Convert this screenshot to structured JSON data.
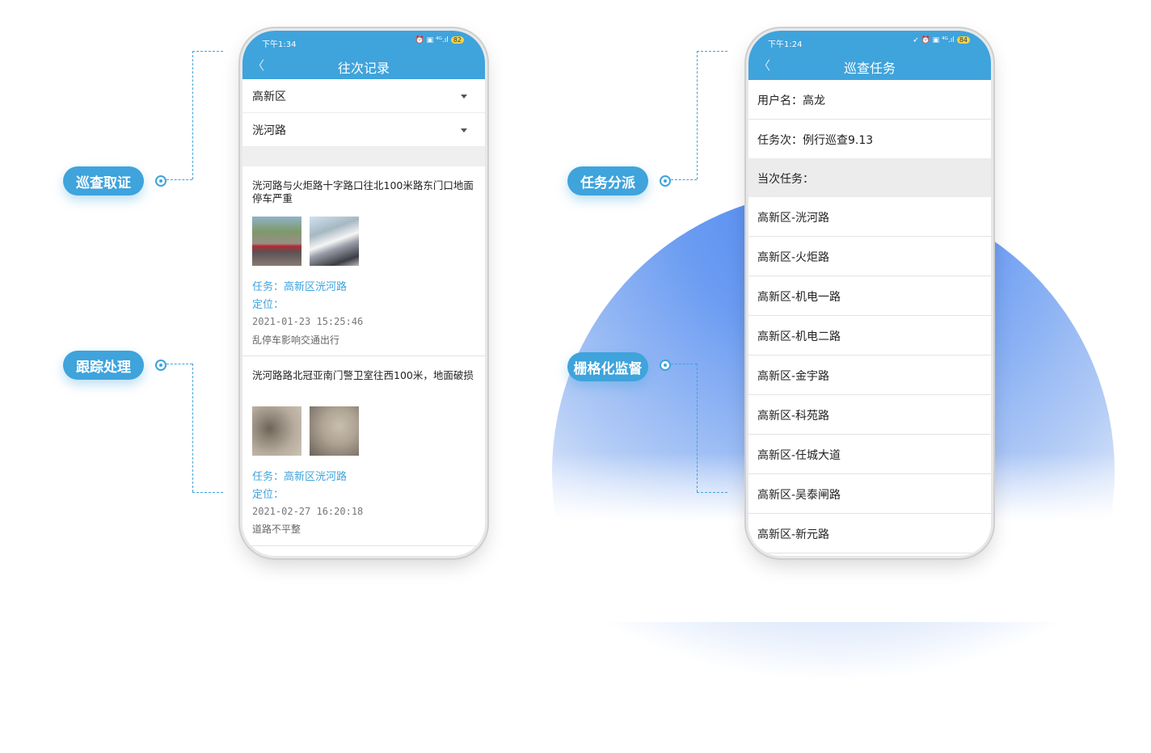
{
  "features": {
    "inspect_evidence": "巡查取证",
    "track_process": "跟踪处理",
    "task_dispatch": "任务分派",
    "grid_supervision": "栅格化监督"
  },
  "left_phone": {
    "status_time": "下午1:34",
    "battery": "82",
    "title": "往次记录",
    "back_icon": "chevron-left-icon",
    "filter_district": "高新区",
    "filter_road": "洸河路",
    "records": [
      {
        "title": "洸河路与火炬路十字路口往北100米路东门口地面停车严重",
        "task_label": "任务：",
        "task_value": "高新区洸河路",
        "location_label": "定位：",
        "datetime": "2021-01-23  15:25:46",
        "description": "乱停车影响交通出行"
      },
      {
        "title": "洸河路路北冠亚南门警卫室往西100米，地面破损",
        "task_label": "任务：",
        "task_value": "高新区洸河路",
        "location_label": "定位：",
        "datetime": "2021-02-27  16:20:18",
        "description": "道路不平整"
      }
    ]
  },
  "right_phone": {
    "status_time": "下午1:24",
    "battery": "84",
    "title": "巡查任务",
    "back_icon": "chevron-left-icon",
    "username": "用户名：高龙",
    "task_batch": "任务次：例行巡查9.13",
    "current_tasks_header": "当次任务：",
    "tasks": [
      "高新区-洸河路",
      "高新区-火炬路",
      "高新区-机电一路",
      "高新区-机电二路",
      "高新区-金宇路",
      "高新区-科苑路",
      "高新区-任城大道",
      "高新区-吴泰闸路",
      "高新区-新元路"
    ]
  },
  "colors": {
    "accent": "#3fa3dc",
    "background_arc": "#4a86f0"
  }
}
